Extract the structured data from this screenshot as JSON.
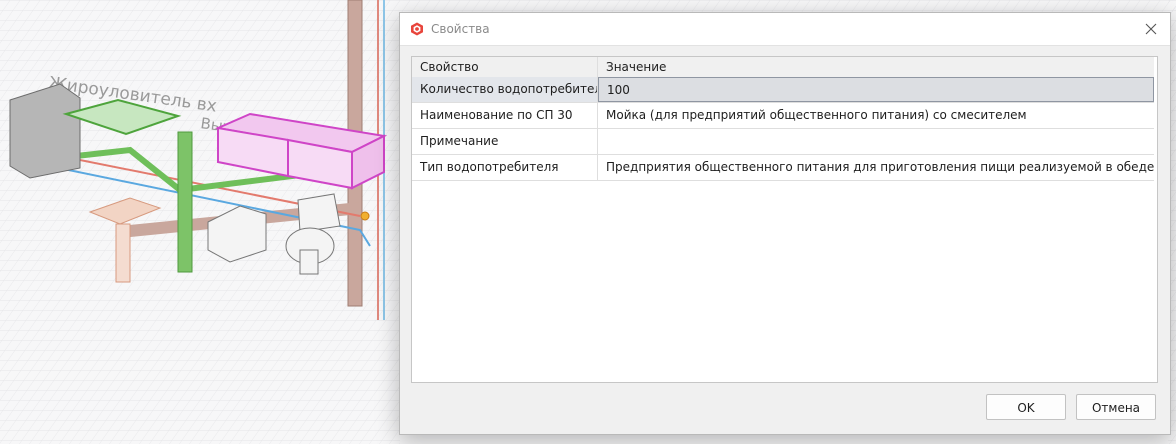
{
  "background": {
    "label_lines": [
      "Жироуловитель вх",
      "Вых"
    ]
  },
  "dialog": {
    "title": "Свойства",
    "app_icon": "app-logo-icon",
    "close_icon": "close-icon",
    "accent_color": "#e8453c"
  },
  "grid": {
    "columns": [
      "Свойство",
      "Значение"
    ],
    "rows": [
      {
        "property": "Количество водопотребителей",
        "value": "100",
        "selected": true
      },
      {
        "property": "Наименование по СП 30",
        "value": "Мойка (для предприятий общественного питания) со смесителем"
      },
      {
        "property": "Примечание",
        "value": ""
      },
      {
        "property": "Тип водопотребителя",
        "value": "Предприятия общественного питания для приготовления пищи реализуемой в обеденном зале"
      }
    ]
  },
  "buttons": {
    "ok": "OK",
    "cancel": "Отмена"
  }
}
